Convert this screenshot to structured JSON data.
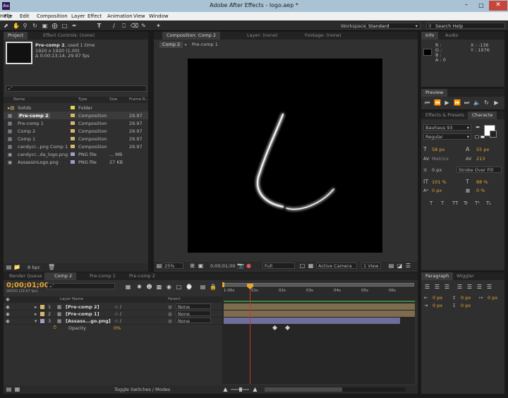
{
  "window": {
    "title": "Adobe After Effects - logo.aep *",
    "app_icon": "Ae"
  },
  "menu": [
    "File",
    "Edit",
    "Composition",
    "Layer",
    "Effect",
    "Animation",
    "View",
    "Window",
    "Help"
  ],
  "toolbar": {
    "workspace_label": "Workspace:",
    "workspace_value": "Standard",
    "search_placeholder": "Search Help"
  },
  "project_panel": {
    "tab_project": "Project",
    "tab_effect_controls": "Effect Controls: (none)",
    "selected_name": "Pre-comp 2",
    "selected_usage": ", used 1 time",
    "selected_size": "1920 x 1920 (1.00)",
    "selected_duration": "Δ 0;00;13;14, 29.97 fps",
    "search_value": "⌕ˇ",
    "columns": {
      "name": "Name",
      "type": "Type",
      "size": "Size",
      "frame_rate": "Frame R..."
    },
    "items": [
      {
        "name": "Solids",
        "type": "Folder",
        "size": "",
        "fps": "",
        "label_color": "#e8d44d",
        "kind": "folder"
      },
      {
        "name": "Pre-comp 2",
        "type": "Composition",
        "size": "",
        "fps": "29.97",
        "label_color": "#d6b76b",
        "kind": "comp",
        "selected": true
      },
      {
        "name": "Pre-comp 1",
        "type": "Composition",
        "size": "",
        "fps": "29.97",
        "label_color": "#d6b76b",
        "kind": "comp"
      },
      {
        "name": "Comp 2",
        "type": "Composition",
        "size": "",
        "fps": "29.97",
        "label_color": "#d6b76b",
        "kind": "comp"
      },
      {
        "name": "Comp 1",
        "type": "Composition",
        "size": "",
        "fps": "29.97",
        "label_color": "#d6b76b",
        "kind": "comp"
      },
      {
        "name": "candycr...png Comp 1",
        "type": "Composition",
        "size": "",
        "fps": "29.97",
        "label_color": "#d6b76b",
        "kind": "comp"
      },
      {
        "name": "candycr...da_logo.png",
        "type": "PNG file",
        "size": "... MB",
        "fps": "",
        "label_color": "#9e9ec9",
        "kind": "file"
      },
      {
        "name": "AssassinLogo.png",
        "type": "PNG file",
        "size": "27 KB",
        "fps": "",
        "label_color": "#9e9ec9",
        "kind": "file"
      }
    ],
    "bpc": "8 bpc"
  },
  "composition_panel": {
    "tab_composition": "Composition: Comp 2",
    "tab_layer": "Layer: (none)",
    "tab_footage": "Footage: (none)",
    "breadcrumb_1": "Comp 2",
    "breadcrumb_2": "Pre-comp 1",
    "zoom": "25%",
    "timecode": "0;00;01;00",
    "resolution": "Full",
    "camera": "Active Camera",
    "views": "1 View"
  },
  "info_panel": {
    "tab_info": "Info",
    "tab_audio": "Audio",
    "r": "R :",
    "g": "G :",
    "b": "B :",
    "a": "A : 0",
    "x": "X : -136",
    "y": "Y : 1976"
  },
  "preview_panel": {
    "tab": "Preview"
  },
  "character_panel": {
    "tab_effects": "Effects & Presets",
    "tab_character": "Characte",
    "font": "Bauhaus 93",
    "style": "Regular",
    "size": "58 px",
    "leading": "55 px",
    "kerning": "Metrics",
    "tracking": "213",
    "stroke_width": "0 px",
    "stroke_type": "Stroke Over Fill",
    "vscale": "101 %",
    "hscale": "88 %",
    "baseline": "0 px",
    "tsume": "0 %",
    "styles": [
      "T",
      "T",
      "TT",
      "Tr",
      "T¹",
      "T₁"
    ]
  },
  "paragraph_panel": {
    "tab_paragraph": "Paragraph",
    "tab_wiggler": "Wiggler",
    "indent_left": "0 px",
    "indent_right": "0 px",
    "indent_first": "0 px",
    "space_before": "0 px",
    "space_after": "0 px"
  },
  "timeline": {
    "tab_render": "Render Queue",
    "tab_comp2": "Comp 2",
    "tab_precomp1": "Pre-comp 1",
    "tab_precomp2": "Pre-comp 2",
    "timecode": "0;00;01;00",
    "frame_info": "00030 (29.97 fps)",
    "search_value": "⌕ˇ",
    "col_layer_name": "Layer Name",
    "col_parent": "Parent",
    "layers": [
      {
        "num": "1",
        "name": "[Pre-comp 2]",
        "parent": "None",
        "label_color": "#d6b76b"
      },
      {
        "num": "2",
        "name": "[Pre-comp 1]",
        "parent": "None",
        "label_color": "#d6b76b"
      },
      {
        "num": "3",
        "name": "[Assass...go.png]",
        "parent": "None",
        "label_color": "#9e9ec9"
      }
    ],
    "opacity_label": "Opacity",
    "opacity_value": "0%",
    "ruler": [
      "1:00s",
      "01s",
      "02s",
      "03s",
      "04s",
      "05s",
      "06s"
    ],
    "toggle_label": "Toggle Switches / Modes"
  },
  "colors": {
    "accent": "#e8a432",
    "playhead": "#c33",
    "ui_bg": "#2f2f2f",
    "title_bar": "#9fb8c9"
  }
}
